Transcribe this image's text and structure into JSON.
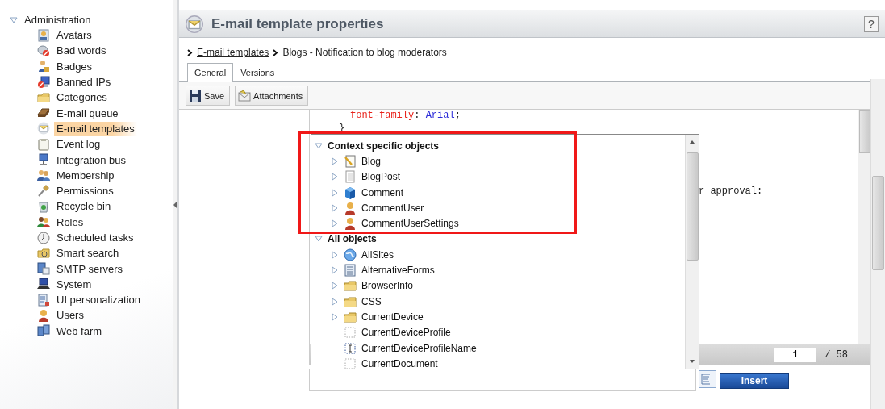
{
  "sidebar": {
    "root": {
      "label": "Administration",
      "expanded": true
    },
    "items": [
      {
        "label": "Avatars",
        "selected": false
      },
      {
        "label": "Bad words",
        "selected": false
      },
      {
        "label": "Badges",
        "selected": false
      },
      {
        "label": "Banned IPs",
        "selected": false
      },
      {
        "label": "Categories",
        "selected": false
      },
      {
        "label": "E-mail queue",
        "selected": false
      },
      {
        "label": "E-mail templates",
        "selected": true
      },
      {
        "label": "Event log",
        "selected": false
      },
      {
        "label": "Integration bus",
        "selected": false
      },
      {
        "label": "Membership",
        "selected": false
      },
      {
        "label": "Permissions",
        "selected": false
      },
      {
        "label": "Recycle bin",
        "selected": false
      },
      {
        "label": "Roles",
        "selected": false
      },
      {
        "label": "Scheduled tasks",
        "selected": false
      },
      {
        "label": "Smart search",
        "selected": false
      },
      {
        "label": "SMTP servers",
        "selected": false
      },
      {
        "label": "System",
        "selected": false
      },
      {
        "label": "UI personalization",
        "selected": false
      },
      {
        "label": "Users",
        "selected": false
      },
      {
        "label": "Web farm",
        "selected": false
      }
    ]
  },
  "header": {
    "title": "E-mail template properties",
    "help": "?"
  },
  "breadcrumb": [
    {
      "label": "E-mail templates",
      "link": true
    },
    {
      "label": "Blogs - Notification to blog moderators",
      "link": false
    }
  ],
  "tabs": [
    {
      "label": "General",
      "selected": true
    },
    {
      "label": "Versions",
      "selected": false
    }
  ],
  "toolbar": [
    "Save",
    "Attachments"
  ],
  "code_lines": [
    {
      "kind": "decl",
      "tokens": [
        "font-family",
        ": ",
        "Arial",
        ";"
      ]
    },
    {
      "kind": "brace",
      "tokens": [
        "}"
      ]
    },
    {
      "kind": "blank"
    },
    {
      "kind": "blank"
    },
    {
      "kind": "blank"
    },
    {
      "kind": "blank"
    },
    {
      "kind": "tail",
      "tokens": [
        "r approval:"
      ]
    }
  ],
  "line_field": {
    "value": "1",
    "total": "/ 58"
  },
  "macro_tree": [
    {
      "label": "Context specific objects",
      "expanded": true,
      "children": [
        {
          "label": "Blog",
          "kind": "collection",
          "expanded": false
        },
        {
          "label": "BlogPost",
          "kind": "collection",
          "expanded": false
        },
        {
          "label": "Comment",
          "kind": "collection",
          "expanded": false
        },
        {
          "label": "CommentUser",
          "kind": "collection",
          "expanded": false
        },
        {
          "label": "CommentUserSettings",
          "kind": "collection",
          "expanded": false
        }
      ]
    },
    {
      "label": "All objects",
      "expanded": true,
      "children": [
        {
          "label": "AllSites",
          "kind": "collection",
          "expanded": false
        },
        {
          "label": "AlternativeForms",
          "kind": "collection",
          "expanded": false
        },
        {
          "label": "BrowserInfo",
          "kind": "collection",
          "expanded": false
        },
        {
          "label": "CSS",
          "kind": "collection",
          "expanded": false
        },
        {
          "label": "CurrentDevice",
          "kind": "collection",
          "expanded": false
        },
        {
          "label": "CurrentDeviceProfile",
          "kind": "value"
        },
        {
          "label": "CurrentDeviceProfileName",
          "kind": "value"
        },
        {
          "label": "CurrentDocument",
          "kind": "value"
        }
      ]
    }
  ],
  "insert_button": "Insert"
}
